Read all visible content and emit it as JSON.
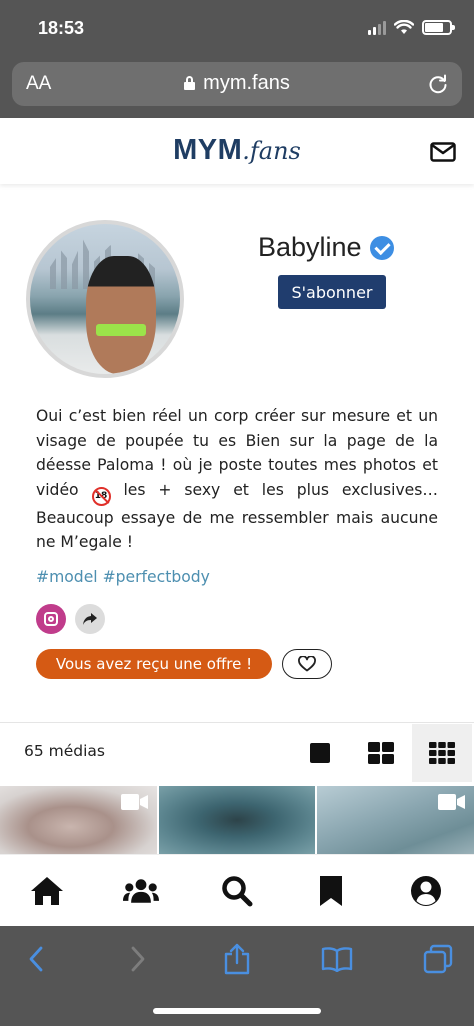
{
  "status_bar": {
    "time": "18:53"
  },
  "browser": {
    "text_size_label": "AA",
    "url": "mym.fans"
  },
  "site": {
    "logo_main": "MYM",
    "logo_suffix": ".fans"
  },
  "profile": {
    "name": "Babyline",
    "subscribe_label": "S'abonner",
    "bio_part1": "Oui c’est bien réel un corp créer sur mesure et un visage de poupée tu es Bien sur la page de la déesse Paloma ! où je poste toutes mes photos et vidéo",
    "bio_emoji": "18",
    "bio_part2": "les + sexy et les plus exclusives… Beaucoup essaye de me ressembler mais aucune ne M’egale !",
    "hashtags": "#model #perfectbody",
    "offer_label": "Vous avez reçu une offre !"
  },
  "media": {
    "count_label": "65 médias"
  },
  "colors": {
    "brand_navy": "#1f3d63",
    "subscribe_bg": "#203d6e",
    "offer_orange": "#d55a14",
    "verified_blue": "#3d8ee3",
    "hashtag_blue": "#4d8fb0",
    "instagram_pink": "#c03c8b",
    "safari_gray": "#555555",
    "safari_tint": "#4a8fe0"
  },
  "icons": {
    "status": [
      "signal-icon",
      "wifi-icon",
      "battery-icon"
    ],
    "browser": [
      "lock-icon",
      "reload-icon"
    ],
    "app_nav": [
      "home-icon",
      "users-icon",
      "search-icon",
      "bookmark-icon",
      "account-icon"
    ],
    "safari_toolbar": [
      "back-icon",
      "forward-icon",
      "share-icon",
      "bookmarks-icon",
      "tabs-icon"
    ]
  }
}
